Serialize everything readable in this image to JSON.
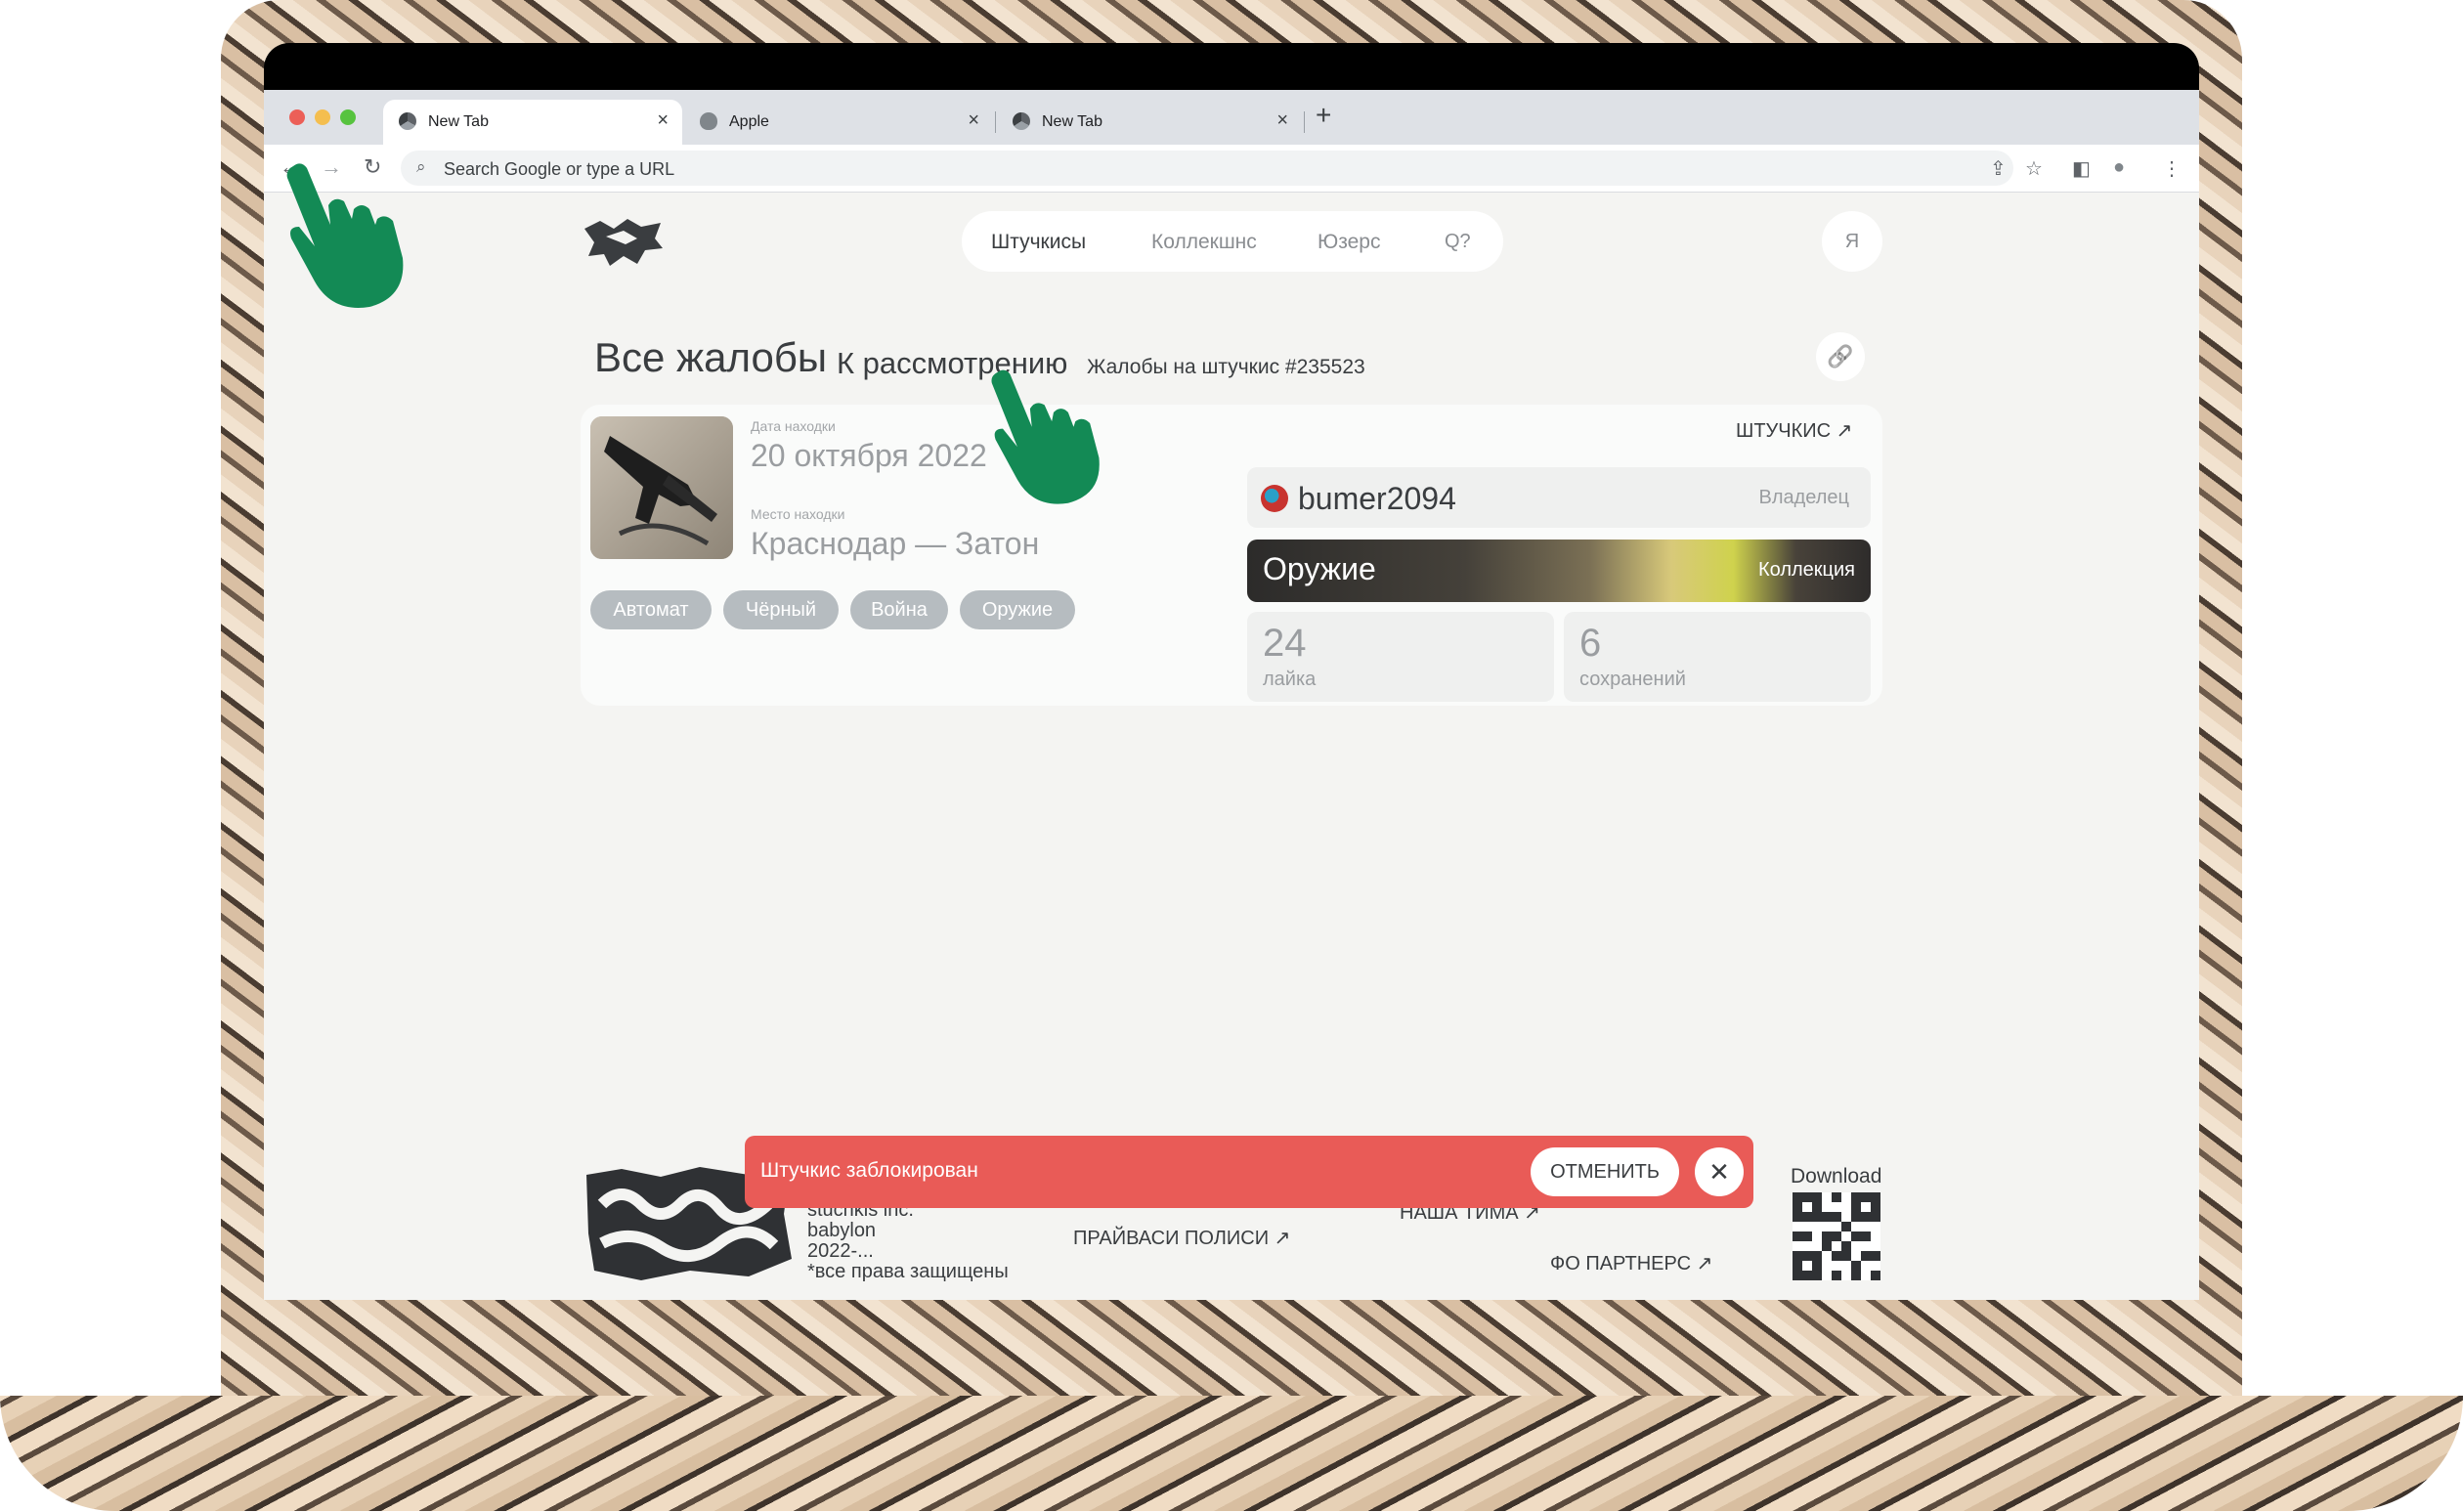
{
  "browser": {
    "tabs": [
      {
        "label": "New Tab",
        "icon": "chrome-icon",
        "active": true
      },
      {
        "label": "Apple",
        "icon": "apple-icon",
        "active": false
      },
      {
        "label": "New Tab",
        "icon": "chrome-icon",
        "active": false
      }
    ],
    "new_tab_symbol": "+",
    "close_symbol": "×",
    "back_symbol": "←",
    "forward_symbol": "→",
    "reload_symbol": "↻",
    "search_icon_symbol": "⌕",
    "omnibox_placeholder": "Search Google or type a URL",
    "toolbar_icons": {
      "share": "⇪",
      "bookmark": "☆",
      "sidepanel": "◧",
      "profile": "●",
      "menu": "⋮"
    }
  },
  "site": {
    "nav": {
      "items": [
        "Штучкисы",
        "Коллекшнс",
        "Юзерс"
      ],
      "search_label": "Q?"
    },
    "profile_label": "Я",
    "heading": {
      "title": "Все жалобы",
      "subtitle": "К рассмотрению",
      "crumb": "Жалобы на штучкис #235523",
      "link_icon": "🔗"
    },
    "item": {
      "date_label": "Дата находки",
      "date_value": "20 октября 2022",
      "place_label": "Место находки",
      "place_value": "Краснодар — Затон",
      "tags": [
        "Автомат",
        "Чёрный",
        "Война",
        "Оружие"
      ],
      "item_link": "ШТУЧКИС ↗",
      "owner_name": "bumer2094",
      "owner_role": "Владелец",
      "collection_name": "Оружие",
      "collection_role": "Коллекция",
      "likes_count": "24",
      "likes_label": "лайка",
      "saves_count": "6",
      "saves_label": "сохранений"
    },
    "footer": {
      "company_lines": [
        "stuchkis inc.",
        "babylon",
        "2022-...",
        "*все права защищены"
      ],
      "links": [
        "ПРАЙВАСИ ПОЛИСИ ↗",
        "НАША ТИМА ↗",
        "ФО ПАРТНЕРС ↗"
      ],
      "download_label": "Download"
    },
    "toast": {
      "message": "Штучкис заблокирован",
      "undo_label": "ОТМЕНИТЬ",
      "close_symbol": "✕",
      "color": "#e95b57"
    }
  },
  "colors": {
    "accent_hand": "#138a55",
    "traffic_red": "#ec5f57",
    "traffic_yellow": "#f4be4f",
    "traffic_green": "#57c33f"
  }
}
